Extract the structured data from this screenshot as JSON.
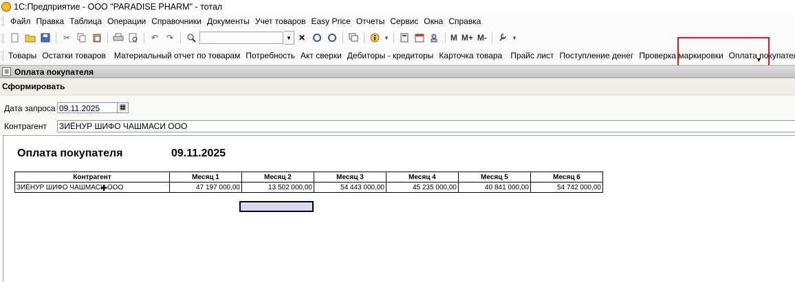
{
  "window": {
    "title": "1С:Предприятие - ООО \"PARADISE PHARM\" - тотал"
  },
  "menu": [
    "Файл",
    "Правка",
    "Таблица",
    "Операции",
    "Справочники",
    "Документы",
    "Учет товаров",
    "Easy Price",
    "Отчеты",
    "Сервис",
    "Окна",
    "Справка"
  ],
  "toolbar": {
    "memory_buttons": [
      "M",
      "M+",
      "M-"
    ]
  },
  "panel": {
    "items": [
      "Товары",
      "Остатки товаров",
      "Материальный отчет по товарам",
      "Потребность",
      "Акт сверки",
      "Дебиторы - кредиторы",
      "Карточка товара",
      "Прайс лист",
      "Поступление денег",
      "Проверка маркировки",
      "Оплата покупателя"
    ],
    "separators_after": [
      1,
      6
    ],
    "highlight_color": "#e0151a"
  },
  "form": {
    "title": "Оплата покупателя",
    "command": "Сформировать",
    "date_label": "Дата запроса",
    "date_value": "09.11.2025",
    "counterparty_label": "Контрагент",
    "counterparty_value": "ЗИЁНУР ШИФО ЧАШМАСИ ООО"
  },
  "report": {
    "title": "Оплата покупателя",
    "date": "09.11.2025",
    "headers": [
      "Контрагент",
      "Месяц 1",
      "Месяц 2",
      "Месяц 3",
      "Месяц 4",
      "Месяц 5",
      "Месяц 6"
    ],
    "rows": [
      [
        "ЗИЁНУР ШИФО ЧАШМАСИ ООО",
        "47 197 000,00",
        "13 502 000,00",
        "54 443 000,00",
        "45 235 000,00",
        "40 841 000,00",
        "54 742 000,00"
      ]
    ]
  }
}
